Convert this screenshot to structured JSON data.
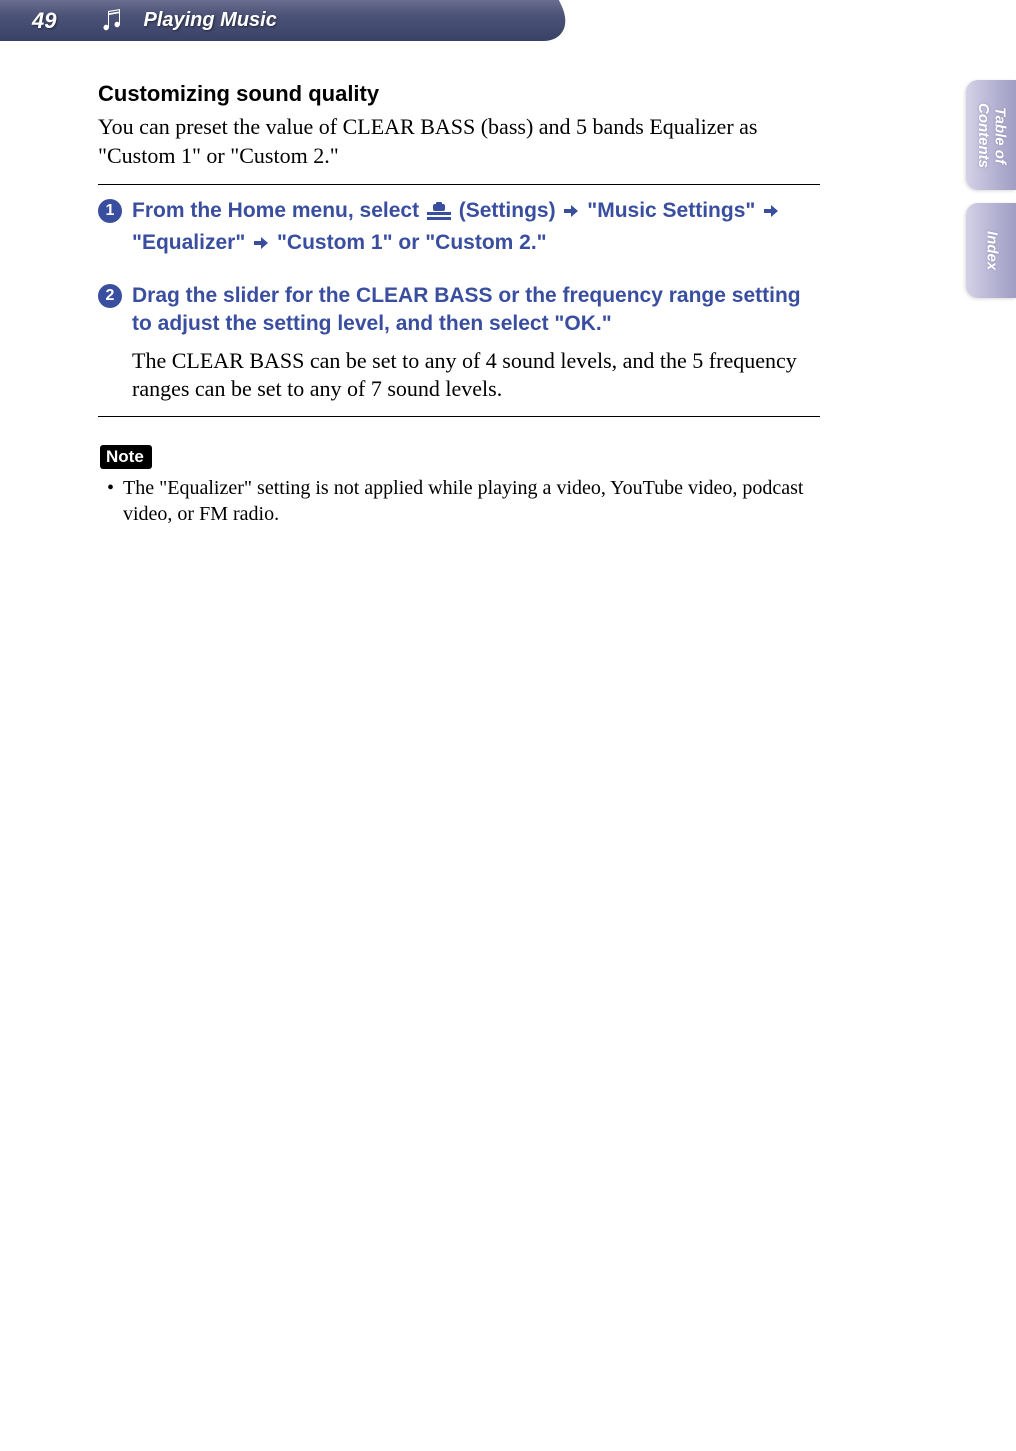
{
  "header": {
    "page_number": "49",
    "section": "Playing Music"
  },
  "side_tabs": {
    "toc": "Table of\nContents",
    "index": "Index"
  },
  "subheading": "Customizing sound quality",
  "intro": "You can preset the value of CLEAR BASS (bass) and 5 bands Equalizer as \"Custom 1\" or \"Custom 2.\"",
  "steps": [
    {
      "num": "1",
      "prefix": "From the Home menu, select ",
      "settings_word": " (Settings) ",
      "path2": " \"Music Settings\" ",
      "path3_prefix": "\"Equalizer\" ",
      "path3_suffix": " \"Custom 1\" or \"Custom 2.\""
    },
    {
      "num": "2",
      "text": "Drag the slider for the CLEAR BASS or the frequency range setting to adjust the setting level, and then select \"OK.\"",
      "body": "The CLEAR BASS can be set to any of 4 sound levels, and the 5 frequency ranges can be set to any of 7 sound levels."
    }
  ],
  "note": {
    "label": "Note",
    "items": [
      "The \"Equalizer\" setting is not applied while playing a video, YouTube video, podcast video, or FM radio."
    ]
  }
}
